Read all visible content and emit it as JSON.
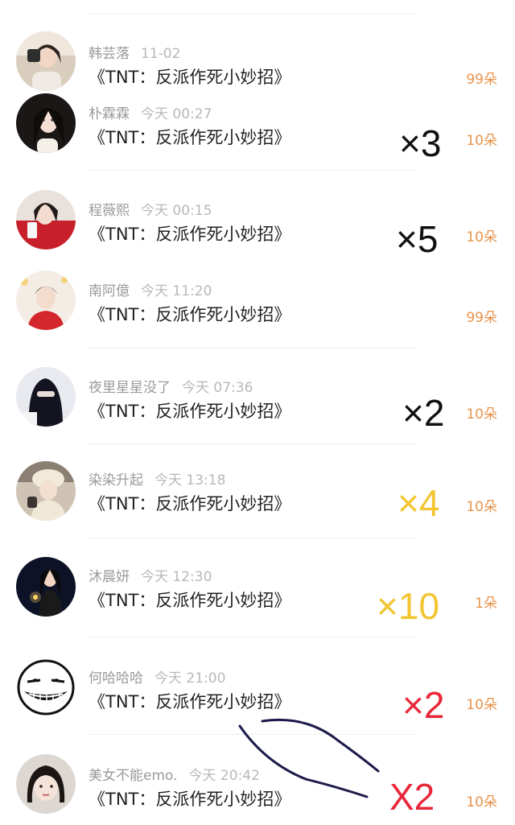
{
  "colors": {
    "flower_count": "#e8934b",
    "name_text": "#9a9a9a",
    "time_text": "#b8b8b8",
    "title_text": "#222222",
    "mark_black": "#111111",
    "mark_yellow": "#f2c531",
    "mark_red": "#e8283a",
    "scribble_ink": "#1c1a4a"
  },
  "rows": [
    {
      "name": "韩芸落",
      "time": "11-02",
      "title": "《TNT：反派作死小妙招》",
      "flowers": "99朵",
      "avatar_icon": "girl-portrait-avatar"
    },
    {
      "name": "朴霖霖",
      "time": "今天 00:27",
      "title": "《TNT：反派作死小妙招》",
      "flowers": "10朵",
      "avatar_icon": "girl-portrait-avatar"
    },
    {
      "name": "程薇熙",
      "time": "今天 00:15",
      "title": "《TNT：反派作死小妙招》",
      "flowers": "10朵",
      "avatar_icon": "girl-red-portrait-avatar"
    },
    {
      "name": "南阿億",
      "time": "今天 11:20",
      "title": "《TNT：反派作死小妙招》",
      "flowers": "99朵",
      "avatar_icon": "boy-portrait-avatar"
    },
    {
      "name": "夜里星星没了",
      "time": "今天 07:36",
      "title": "《TNT：反派作死小妙招》",
      "flowers": "10朵",
      "avatar_icon": "masked-portrait-avatar"
    },
    {
      "name": "染染升起",
      "time": "今天 13:18",
      "title": "《TNT：反派作死小妙招》",
      "flowers": "10朵",
      "avatar_icon": "girl-hat-portrait-avatar"
    },
    {
      "name": "沐晨妍",
      "time": "今天 12:30",
      "title": "《TNT：反派作死小妙招》",
      "flowers": "1朵",
      "avatar_icon": "girl-night-portrait-avatar"
    },
    {
      "name": "何哈哈哈",
      "time": "今天 21:00",
      "title": "《TNT：反派作死小妙招》",
      "flowers": "10朵",
      "avatar_icon": "grin-face-cartoon-avatar"
    },
    {
      "name": "美女不能emo.",
      "time": "今天 20:42",
      "title": "《TNT：反派作死小妙招》",
      "flowers": "10朵",
      "avatar_icon": "girl-selfie-portrait-avatar"
    }
  ],
  "annotations": {
    "mark_1": "×3",
    "mark_2": "×5",
    "mark_3": "×2",
    "mark_4": "×4",
    "mark_5": "×10",
    "mark_6": "×2",
    "mark_7": "X2"
  }
}
